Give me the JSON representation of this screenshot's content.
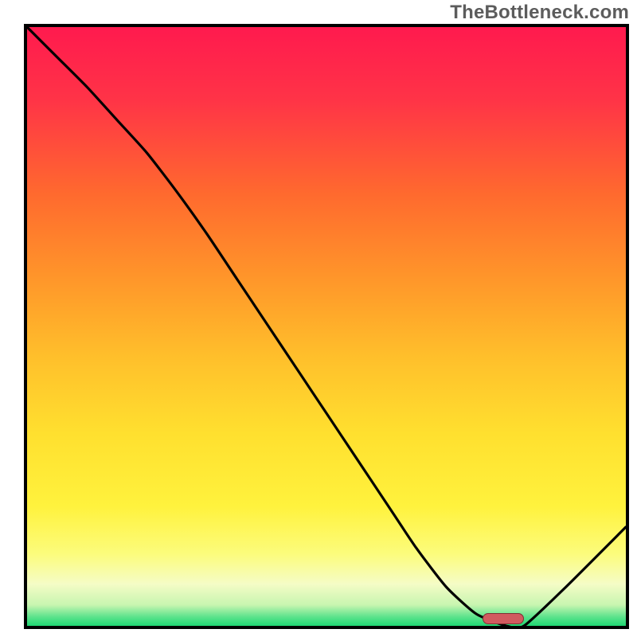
{
  "watermark": "TheBottleneck.com",
  "chart_data": {
    "type": "line",
    "title": "",
    "xlabel": "",
    "ylabel": "",
    "xlim": [
      0,
      100
    ],
    "ylim": [
      0,
      100
    ],
    "x": [
      0,
      5,
      10,
      15,
      20,
      25,
      30,
      35,
      40,
      45,
      50,
      55,
      60,
      65,
      70,
      75,
      80,
      83,
      90,
      100
    ],
    "y": [
      100,
      95,
      90,
      84.5,
      79,
      72.5,
      65.5,
      58,
      50.5,
      43,
      35.5,
      28,
      20.5,
      13,
      6.5,
      2,
      0,
      0,
      6.5,
      16.5
    ],
    "marker": {
      "x_start": 76,
      "x_end": 83,
      "y": 0
    },
    "gradient_stops": [
      {
        "offset": 0.0,
        "color": "#ff1a4e"
      },
      {
        "offset": 0.12,
        "color": "#ff3347"
      },
      {
        "offset": 0.28,
        "color": "#ff6a2e"
      },
      {
        "offset": 0.42,
        "color": "#ff962a"
      },
      {
        "offset": 0.55,
        "color": "#ffbf2b"
      },
      {
        "offset": 0.68,
        "color": "#ffe02f"
      },
      {
        "offset": 0.8,
        "color": "#fff23d"
      },
      {
        "offset": 0.88,
        "color": "#fcfc7c"
      },
      {
        "offset": 0.93,
        "color": "#f5fcc6"
      },
      {
        "offset": 0.965,
        "color": "#c8f5b0"
      },
      {
        "offset": 0.985,
        "color": "#5ce38c"
      },
      {
        "offset": 1.0,
        "color": "#1fd672"
      }
    ]
  }
}
